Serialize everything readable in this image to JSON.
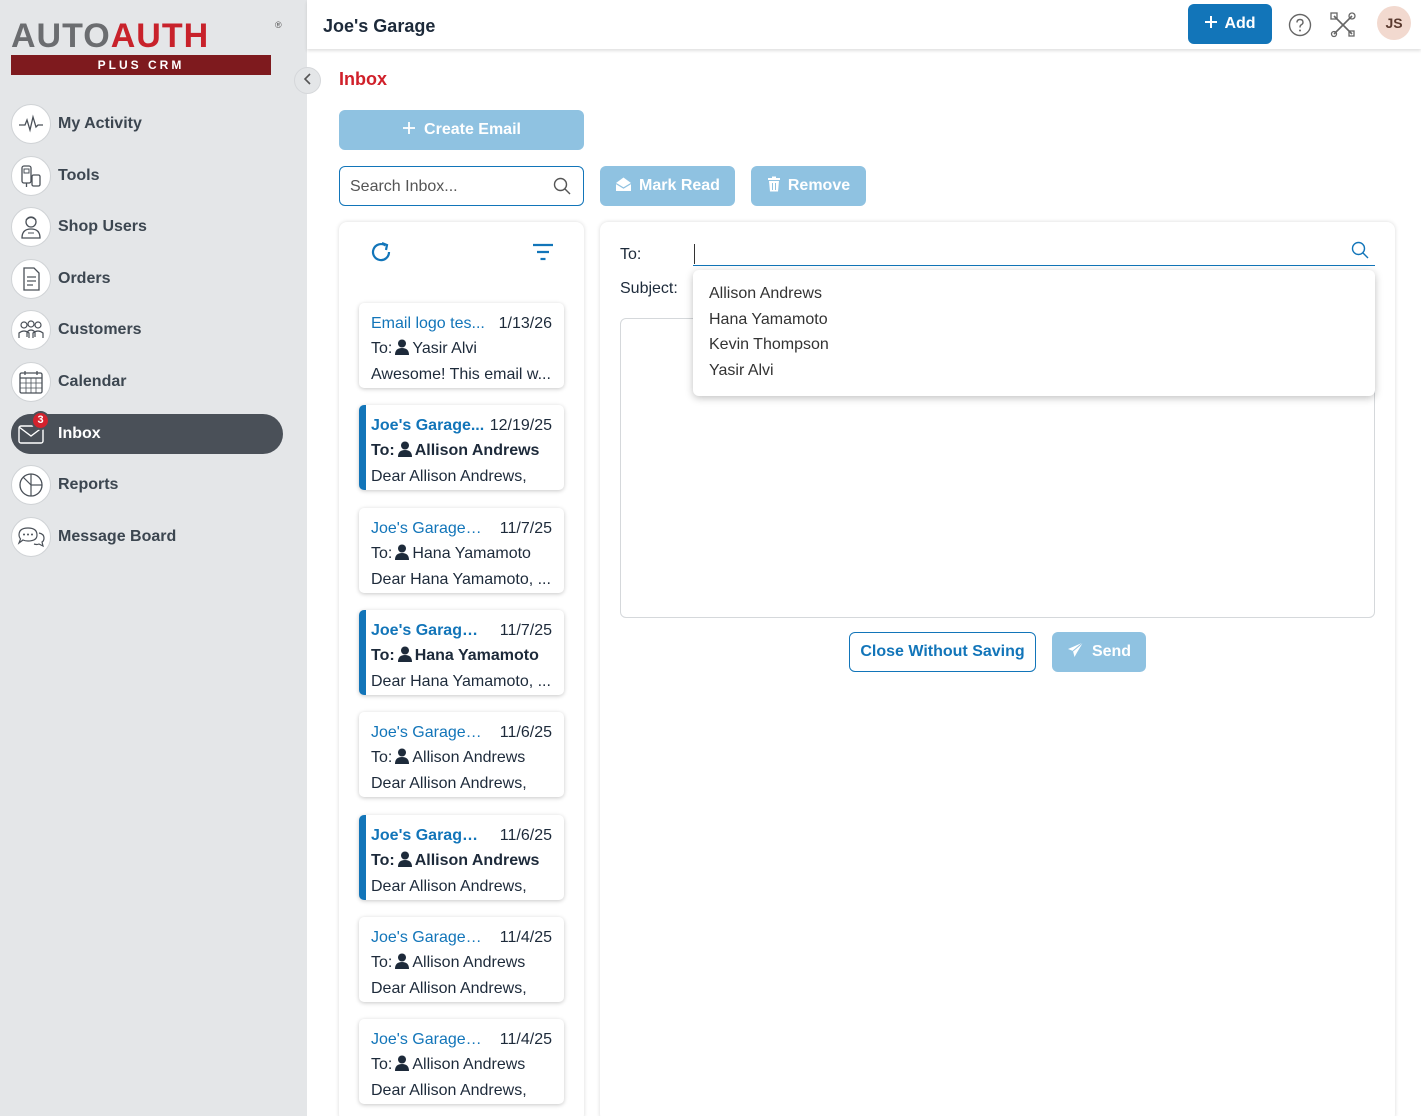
{
  "brand": {
    "logo_part1": "AUTO",
    "logo_part2": "AUTH",
    "logo_reg": "®",
    "logo_sub": "PLUS CRM"
  },
  "header": {
    "shop_name": "Joe's Garage",
    "add_label": "Add",
    "avatar_initials": "JS"
  },
  "sidebar": {
    "items": [
      {
        "label": "My Activity",
        "icon": "activity-icon"
      },
      {
        "label": "Tools",
        "icon": "tools-icon"
      },
      {
        "label": "Shop Users",
        "icon": "shop-users-icon"
      },
      {
        "label": "Orders",
        "icon": "orders-icon"
      },
      {
        "label": "Customers",
        "icon": "customers-icon"
      },
      {
        "label": "Calendar",
        "icon": "calendar-icon"
      },
      {
        "label": "Inbox",
        "icon": "mail-icon",
        "badge": "3",
        "active": true
      },
      {
        "label": "Reports",
        "icon": "reports-icon"
      },
      {
        "label": "Message Board",
        "icon": "chat-icon"
      }
    ]
  },
  "main": {
    "title": "Inbox",
    "create_email_label": "Create Email",
    "search_placeholder": "Search Inbox...",
    "mark_read_label": "Mark Read",
    "remove_label": "Remove"
  },
  "emails": [
    {
      "subject": "Email logo tes...",
      "date": "1/13/26",
      "to_label": "To:",
      "to": "Yasir Alvi",
      "preview": "Awesome! This email w...",
      "unread": false
    },
    {
      "subject": "Joe's Garage...",
      "date": "12/19/25",
      "to_label": "To:",
      "to": "Allison Andrews",
      "preview": "Dear Allison Andrews, Y...",
      "unread": true
    },
    {
      "subject": "Joe's Garage -...",
      "date": "11/7/25",
      "to_label": "To:",
      "to": "Hana Yamamoto",
      "preview": "Dear Hana Yamamoto, ...",
      "unread": false
    },
    {
      "subject": "Joe's Garage ...",
      "date": "11/7/25",
      "to_label": "To:",
      "to": "Hana Yamamoto",
      "preview": "Dear Hana Yamamoto, ...",
      "unread": true
    },
    {
      "subject": "Joe's Garage -...",
      "date": "11/6/25",
      "to_label": "To:",
      "to": "Allison Andrews",
      "preview": "Dear Allison Andrews, Y...",
      "unread": false
    },
    {
      "subject": "Joe's Garage ...",
      "date": "11/6/25",
      "to_label": "To:",
      "to": "Allison Andrews",
      "preview": "Dear Allison Andrews, Y...",
      "unread": true
    },
    {
      "subject": "Joe's Garage -...",
      "date": "11/4/25",
      "to_label": "To:",
      "to": "Allison Andrews",
      "preview": "Dear Allison Andrews, Y...",
      "unread": false
    },
    {
      "subject": "Joe's Garage -...",
      "date": "11/4/25",
      "to_label": "To:",
      "to": "Allison Andrews",
      "preview": "Dear Allison Andrews, Y...",
      "unread": false
    }
  ],
  "compose": {
    "to_label": "To:",
    "subject_label": "Subject:",
    "to_value": "",
    "suggestions": [
      "Allison Andrews",
      "Hana Yamamoto",
      "Kevin Thompson",
      "Yasir Alvi"
    ],
    "close_label": "Close Without Saving",
    "send_label": "Send"
  },
  "colors": {
    "accent": "#1275b9",
    "accent_disabled": "#8fc2e1",
    "title_red": "#d0202a",
    "sidebar_bg": "#e4e6e8",
    "active_nav": "#4a5058"
  }
}
